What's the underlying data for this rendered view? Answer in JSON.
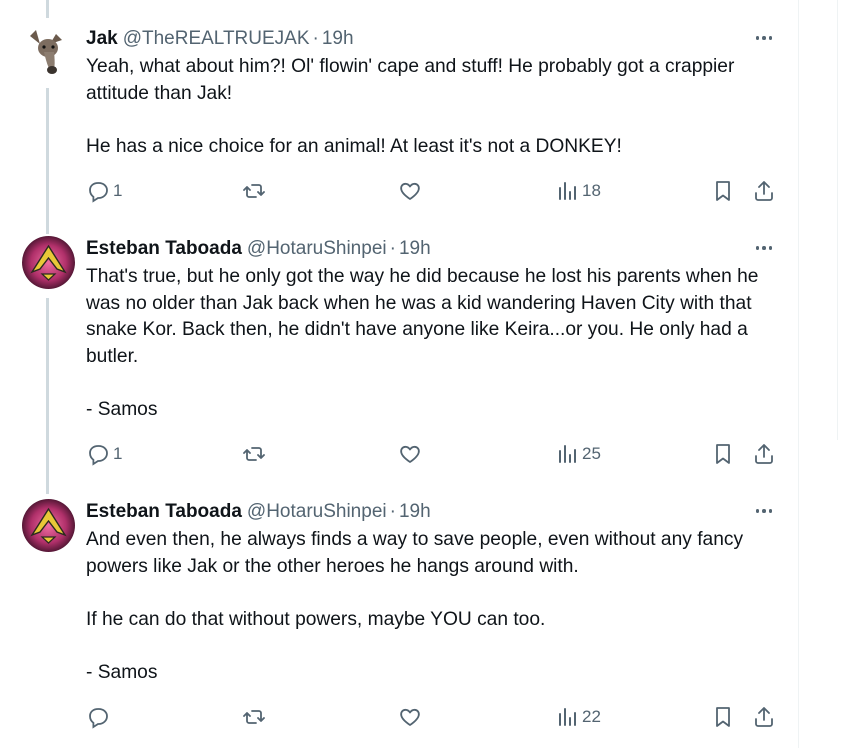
{
  "tweets": [
    {
      "name": "Jak",
      "handle": "@TheREALTRUEJAK",
      "time": "19h",
      "avatar": "donkey-avatar",
      "paragraphs": [
        "Yeah, what about him?! Ol' flowin' cape and stuff! He probably got a crappier attitude than Jak!",
        "He has a nice choice for an animal! At least it's not a DONKEY!"
      ],
      "replies": "1",
      "retweets": "",
      "likes": "",
      "views": "18"
    },
    {
      "name": "Esteban Taboada",
      "handle": "@HotaruShinpei",
      "time": "19h",
      "avatar": "emblem-avatar",
      "paragraphs": [
        "That's true, but he only got the way he did because he lost his parents when he was no older than Jak back when he was a kid wandering Haven City with that snake Kor. Back then, he didn't have anyone like Keira...or you. He only had a butler.",
        "- Samos"
      ],
      "replies": "1",
      "retweets": "",
      "likes": "",
      "views": "25"
    },
    {
      "name": "Esteban Taboada",
      "handle": "@HotaruShinpei",
      "time": "19h",
      "avatar": "emblem-avatar",
      "paragraphs": [
        "And even then, he always finds a way to save people, even without any fancy powers like Jak or the other heroes he hangs around with.",
        "If he can do that without powers, maybe YOU can too.",
        "- Samos"
      ],
      "replies": "",
      "retweets": "",
      "likes": "",
      "views": "22"
    }
  ],
  "colors": {
    "text": "#0f1419",
    "secondary": "#536471",
    "thread_line": "#cfd9de",
    "emblem_bg": "#b0306a",
    "emblem_gold": "#e8c838"
  }
}
